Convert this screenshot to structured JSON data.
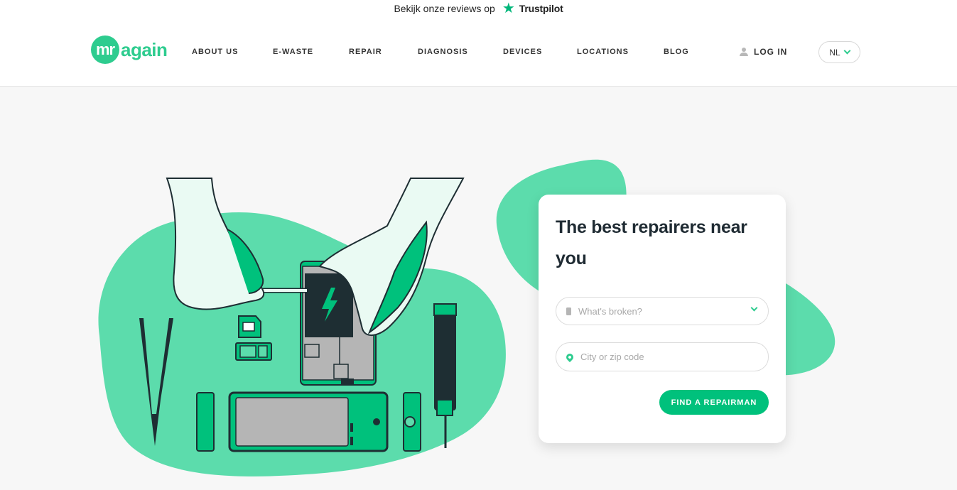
{
  "reviews": {
    "text": "Bekijk onze reviews op",
    "brand": "Trustpilot"
  },
  "logo": {
    "mark": "mr",
    "word": "again"
  },
  "nav": [
    {
      "label": "ABOUT US"
    },
    {
      "label": "E-WASTE"
    },
    {
      "label": "REPAIR"
    },
    {
      "label": "DIAGNOSIS"
    },
    {
      "label": "DEVICES"
    },
    {
      "label": "LOCATIONS"
    },
    {
      "label": "BLOG"
    }
  ],
  "login": {
    "label": "LOG IN",
    "icon": "user-icon"
  },
  "language": {
    "selected": "NL",
    "icon": "chevron-down-icon"
  },
  "hero": {
    "title": "The best repairers near you",
    "broken_placeholder": "What's broken?",
    "location_placeholder": "City or zip code",
    "button_label": "FIND A REPAIRMAN"
  },
  "colors": {
    "accent": "#2ecc8f",
    "blob": "#5cdcac",
    "button": "#00c17c",
    "trustpilot": "#00b67a"
  }
}
